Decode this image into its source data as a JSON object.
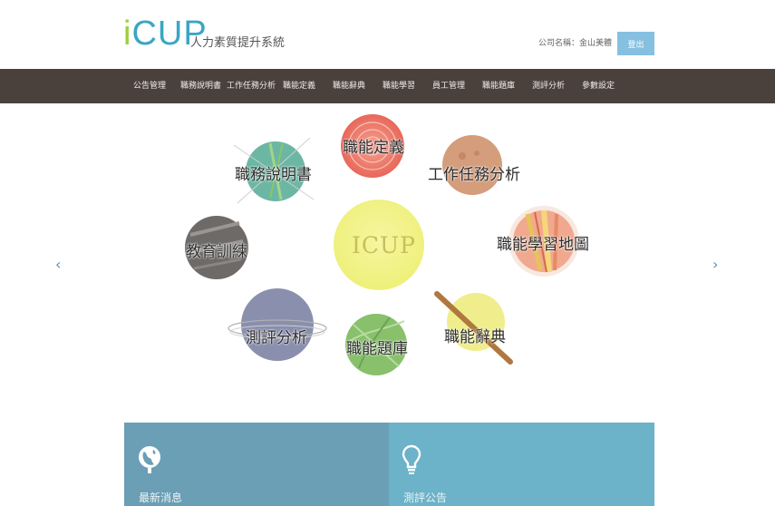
{
  "header": {
    "logo_text": "iCUP",
    "logo_i": "i",
    "logo_rest": "CUP",
    "subtitle": "人力素質提升系統",
    "company_label": "公司名稱：金山美體",
    "logout_label": "登出"
  },
  "nav": {
    "items": [
      {
        "label": "公告管理"
      },
      {
        "label": "職務說明書"
      },
      {
        "label": "工作任務分析"
      },
      {
        "label": "職能定義"
      },
      {
        "label": "職能辭典"
      },
      {
        "label": "職能學習"
      },
      {
        "label": "員工管理"
      },
      {
        "label": "職能題庫"
      },
      {
        "label": "測評分析"
      },
      {
        "label": "參數設定"
      }
    ]
  },
  "hero": {
    "center_label": "ICUP",
    "prev_arrow": "‹",
    "next_arrow": "›",
    "planets": [
      {
        "label": "職能定義"
      },
      {
        "label": "工作任務分析"
      },
      {
        "label": "職能學習地圖"
      },
      {
        "label": "職能辭典"
      },
      {
        "label": "職能題庫"
      },
      {
        "label": "測評分析"
      },
      {
        "label": "教育訓練"
      },
      {
        "label": "職務說明書"
      }
    ]
  },
  "panels": {
    "news_title": "最新消息",
    "eval_title": "測評公告"
  },
  "colors": {
    "nav_bg": "#4a403c",
    "brand_blue": "#3aa6c4",
    "brand_green": "#9ecf3a",
    "panel_news": "#6a9fb5",
    "panel_eval": "#6cb2c8",
    "logout_bg": "#86c0e0"
  },
  "icons": {
    "news": "globe-icon",
    "eval": "lightbulb-icon"
  }
}
